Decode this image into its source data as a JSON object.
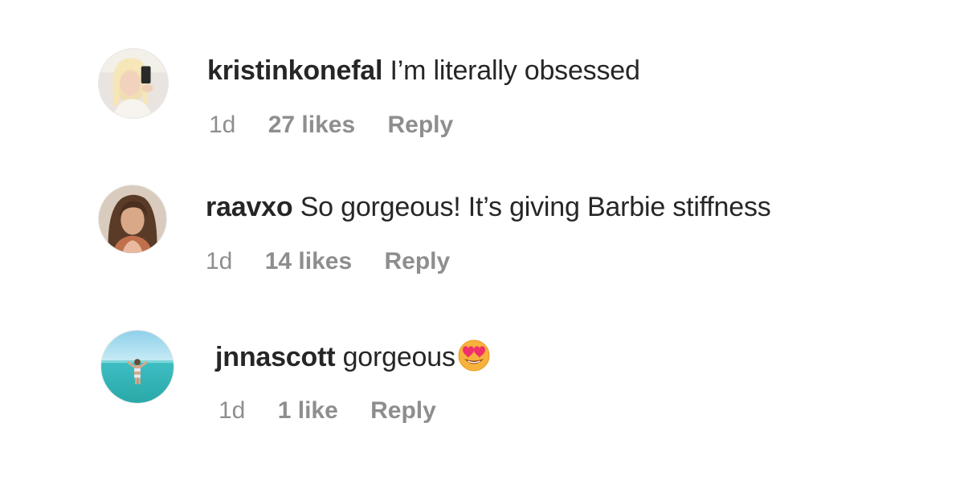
{
  "comments": [
    {
      "username": "kristinkonefal",
      "text": "I’m literally obsessed",
      "emoji": "",
      "time": "1d",
      "likes": "27 likes",
      "reply": "Reply"
    },
    {
      "username": "raavxo",
      "text": "So gorgeous! It’s giving Barbie stiffness",
      "emoji": "",
      "time": "1d",
      "likes": "14 likes",
      "reply": "Reply"
    },
    {
      "username": "jnnascott",
      "text": "gorgeous",
      "emoji": "heart-eyes-emoji",
      "time": "1d",
      "likes": "1 like",
      "reply": "Reply"
    }
  ],
  "colors": {
    "text": "#262626",
    "meta": "#8e8e8e",
    "background": "#ffffff"
  }
}
